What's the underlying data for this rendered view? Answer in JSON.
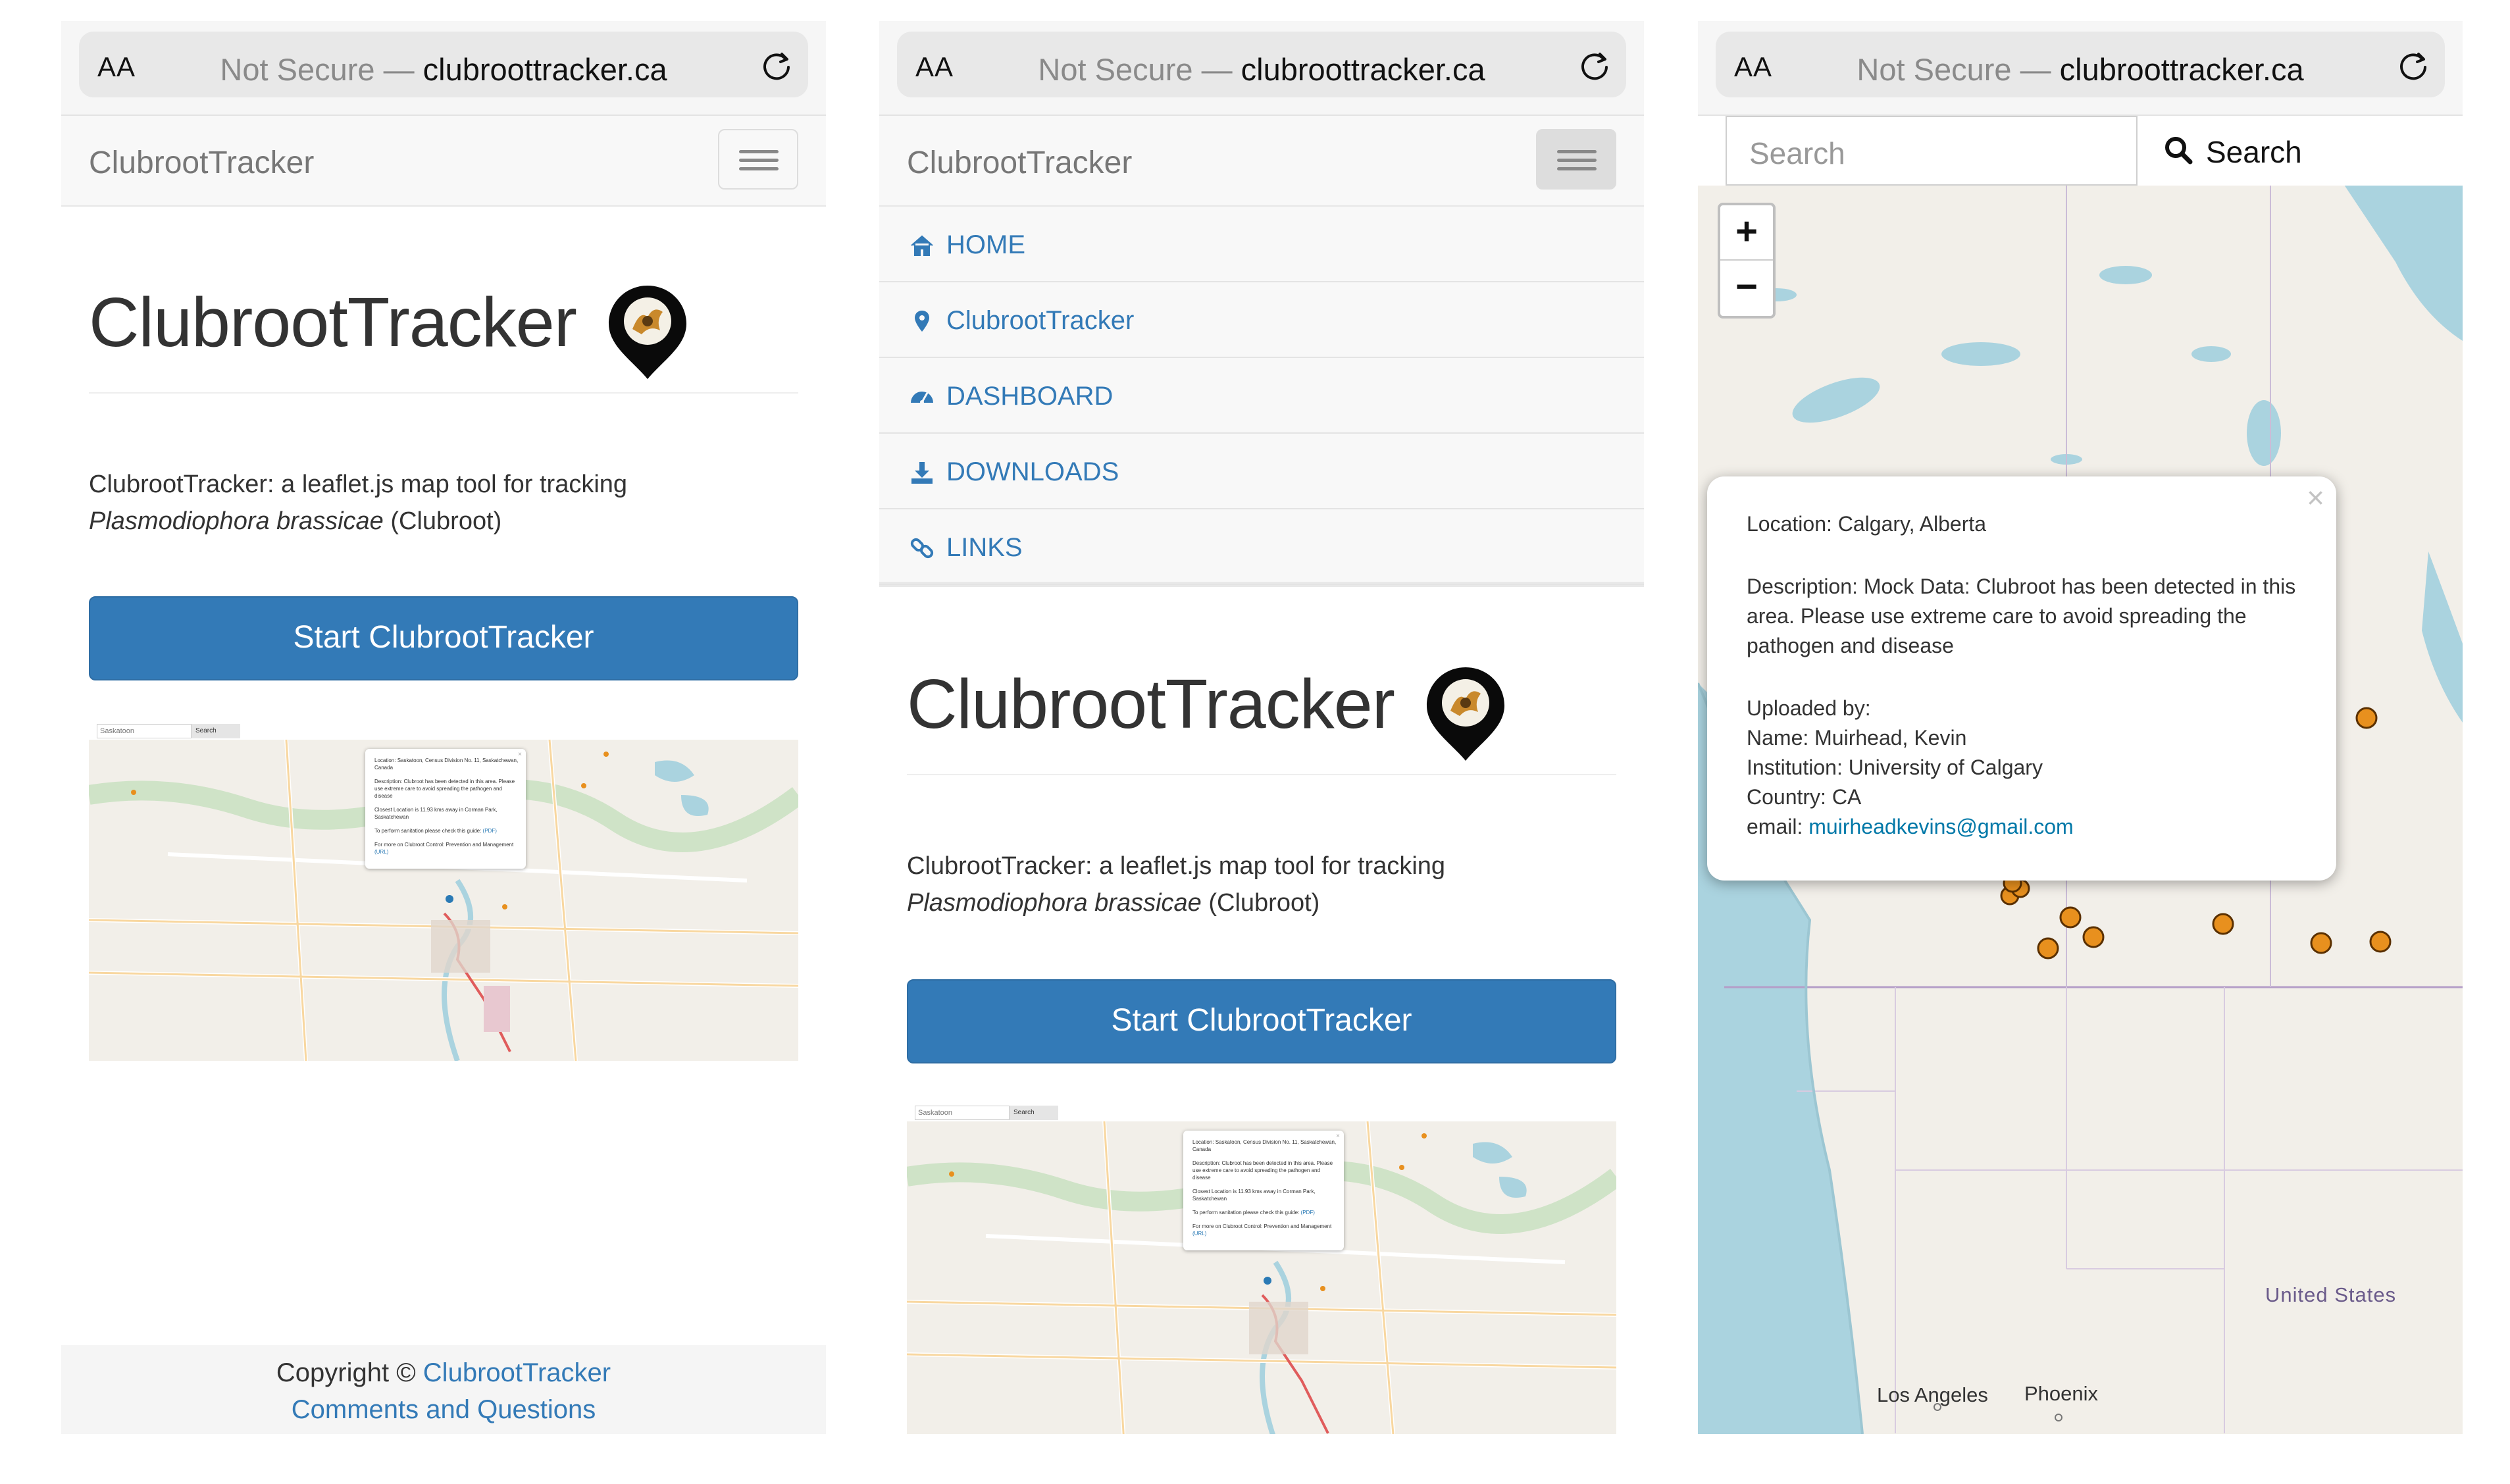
{
  "browser": {
    "aa_label": "AA",
    "not_secure": "Not Secure — ",
    "domain": "clubroottracker.ca"
  },
  "navbar": {
    "brand": "ClubrootTracker"
  },
  "hero": {
    "title": "ClubrootTracker",
    "lead_prefix": "ClubrootTracker: a leaflet.js map tool for tracking",
    "lead_species": "Plasmodiophora brassicae",
    "lead_suffix": " (Clubroot)",
    "start_button": "Start ClubrootTracker"
  },
  "thumbnail": {
    "search_value": "Saskatoon",
    "search_button": "Search",
    "popup_location": "Location: Saskatoon, Census Division No. 11, Saskatchewan, Canada",
    "popup_description": "Description: Clubroot has been detected in this area. Please use extreme care to avoid spreading the pathogen and disease",
    "popup_closest": "Closest Location is 11.93 kms away in Corman Park, Saskatchewan",
    "popup_sanitation_text": "To perform sanitation please check this guide: ",
    "popup_sanitation_link": "(PDF)",
    "popup_more_text": "For more on Clubroot Control: Prevention and Management ",
    "popup_more_link": "(URL)"
  },
  "footer": {
    "copyright": "Copyright © ",
    "copyright_link": "ClubrootTracker",
    "comments_link": "Comments and Questions"
  },
  "menu": {
    "items": [
      {
        "label": "HOME",
        "icon": "home-icon"
      },
      {
        "label": "ClubrootTracker",
        "icon": "map-marker-icon"
      },
      {
        "label": "DASHBOARD",
        "icon": "dashboard-icon"
      },
      {
        "label": "DOWNLOADS",
        "icon": "download-icon"
      },
      {
        "label": "LINKS",
        "icon": "link-icon"
      }
    ]
  },
  "map_view": {
    "search_placeholder": "Search",
    "search_button": "Search",
    "zoom_in": "+",
    "zoom_out": "−",
    "popup": {
      "close": "×",
      "location": "Location: Calgary, Alberta",
      "description": "Description: Mock Data: Clubroot has been detected in this area. Please use extreme care to avoid spreading the pathogen and disease",
      "uploaded_by": "Uploaded by:",
      "name": "Name: Muirhead, Kevin",
      "institution": "Institution: University of Calgary",
      "country": "Country: CA",
      "email_label": "email: ",
      "email": "muirheadkevins@gmail.com"
    },
    "labels": {
      "united_states": "United States",
      "los_angeles": "Los Angeles",
      "phoenix": "Phoenix"
    },
    "marker_color": "#e8901e"
  },
  "colors": {
    "primary": "#337ab7",
    "link": "#337ab7",
    "map_water": "#aad3df",
    "map_land": "#f2efe9"
  }
}
